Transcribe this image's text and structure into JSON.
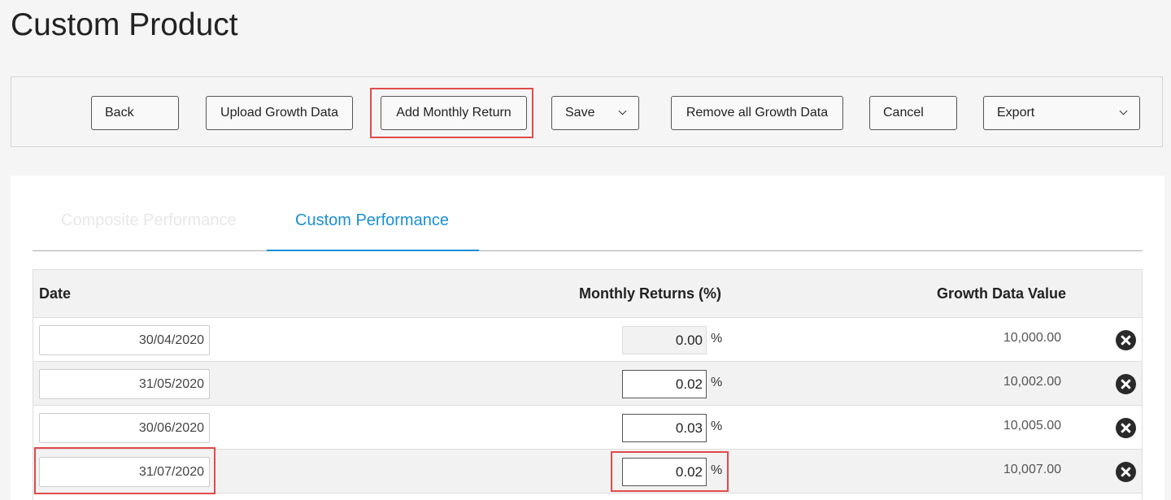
{
  "page": {
    "title": "Custom Product"
  },
  "toolbar": {
    "back_label": "Back",
    "upload_label": "Upload Growth Data",
    "add_monthly_label": "Add Monthly Return",
    "save_label": "Save",
    "remove_all_label": "Remove all Growth Data",
    "cancel_label": "Cancel",
    "export_label": "Export"
  },
  "tabs": [
    {
      "label": "Composite Performance",
      "active": false
    },
    {
      "label": "Custom Performance",
      "active": true
    }
  ],
  "table": {
    "headers": {
      "date": "Date",
      "returns": "Monthly Returns (%)",
      "growth": "Growth Data Value"
    },
    "rows": [
      {
        "date": "30/04/2020",
        "return": "0.00",
        "unit": "%",
        "growth": "10,000.00",
        "readonly": true
      },
      {
        "date": "31/05/2020",
        "return": "0.02",
        "unit": "%",
        "growth": "10,002.00",
        "readonly": false
      },
      {
        "date": "30/06/2020",
        "return": "0.03",
        "unit": "%",
        "growth": "10,005.00",
        "readonly": false
      },
      {
        "date": "31/07/2020",
        "return": "0.02",
        "unit": "%",
        "growth": "10,007.00",
        "readonly": false
      }
    ]
  },
  "colors": {
    "accent": "#1a8fd6",
    "highlight": "#e24a4a"
  }
}
